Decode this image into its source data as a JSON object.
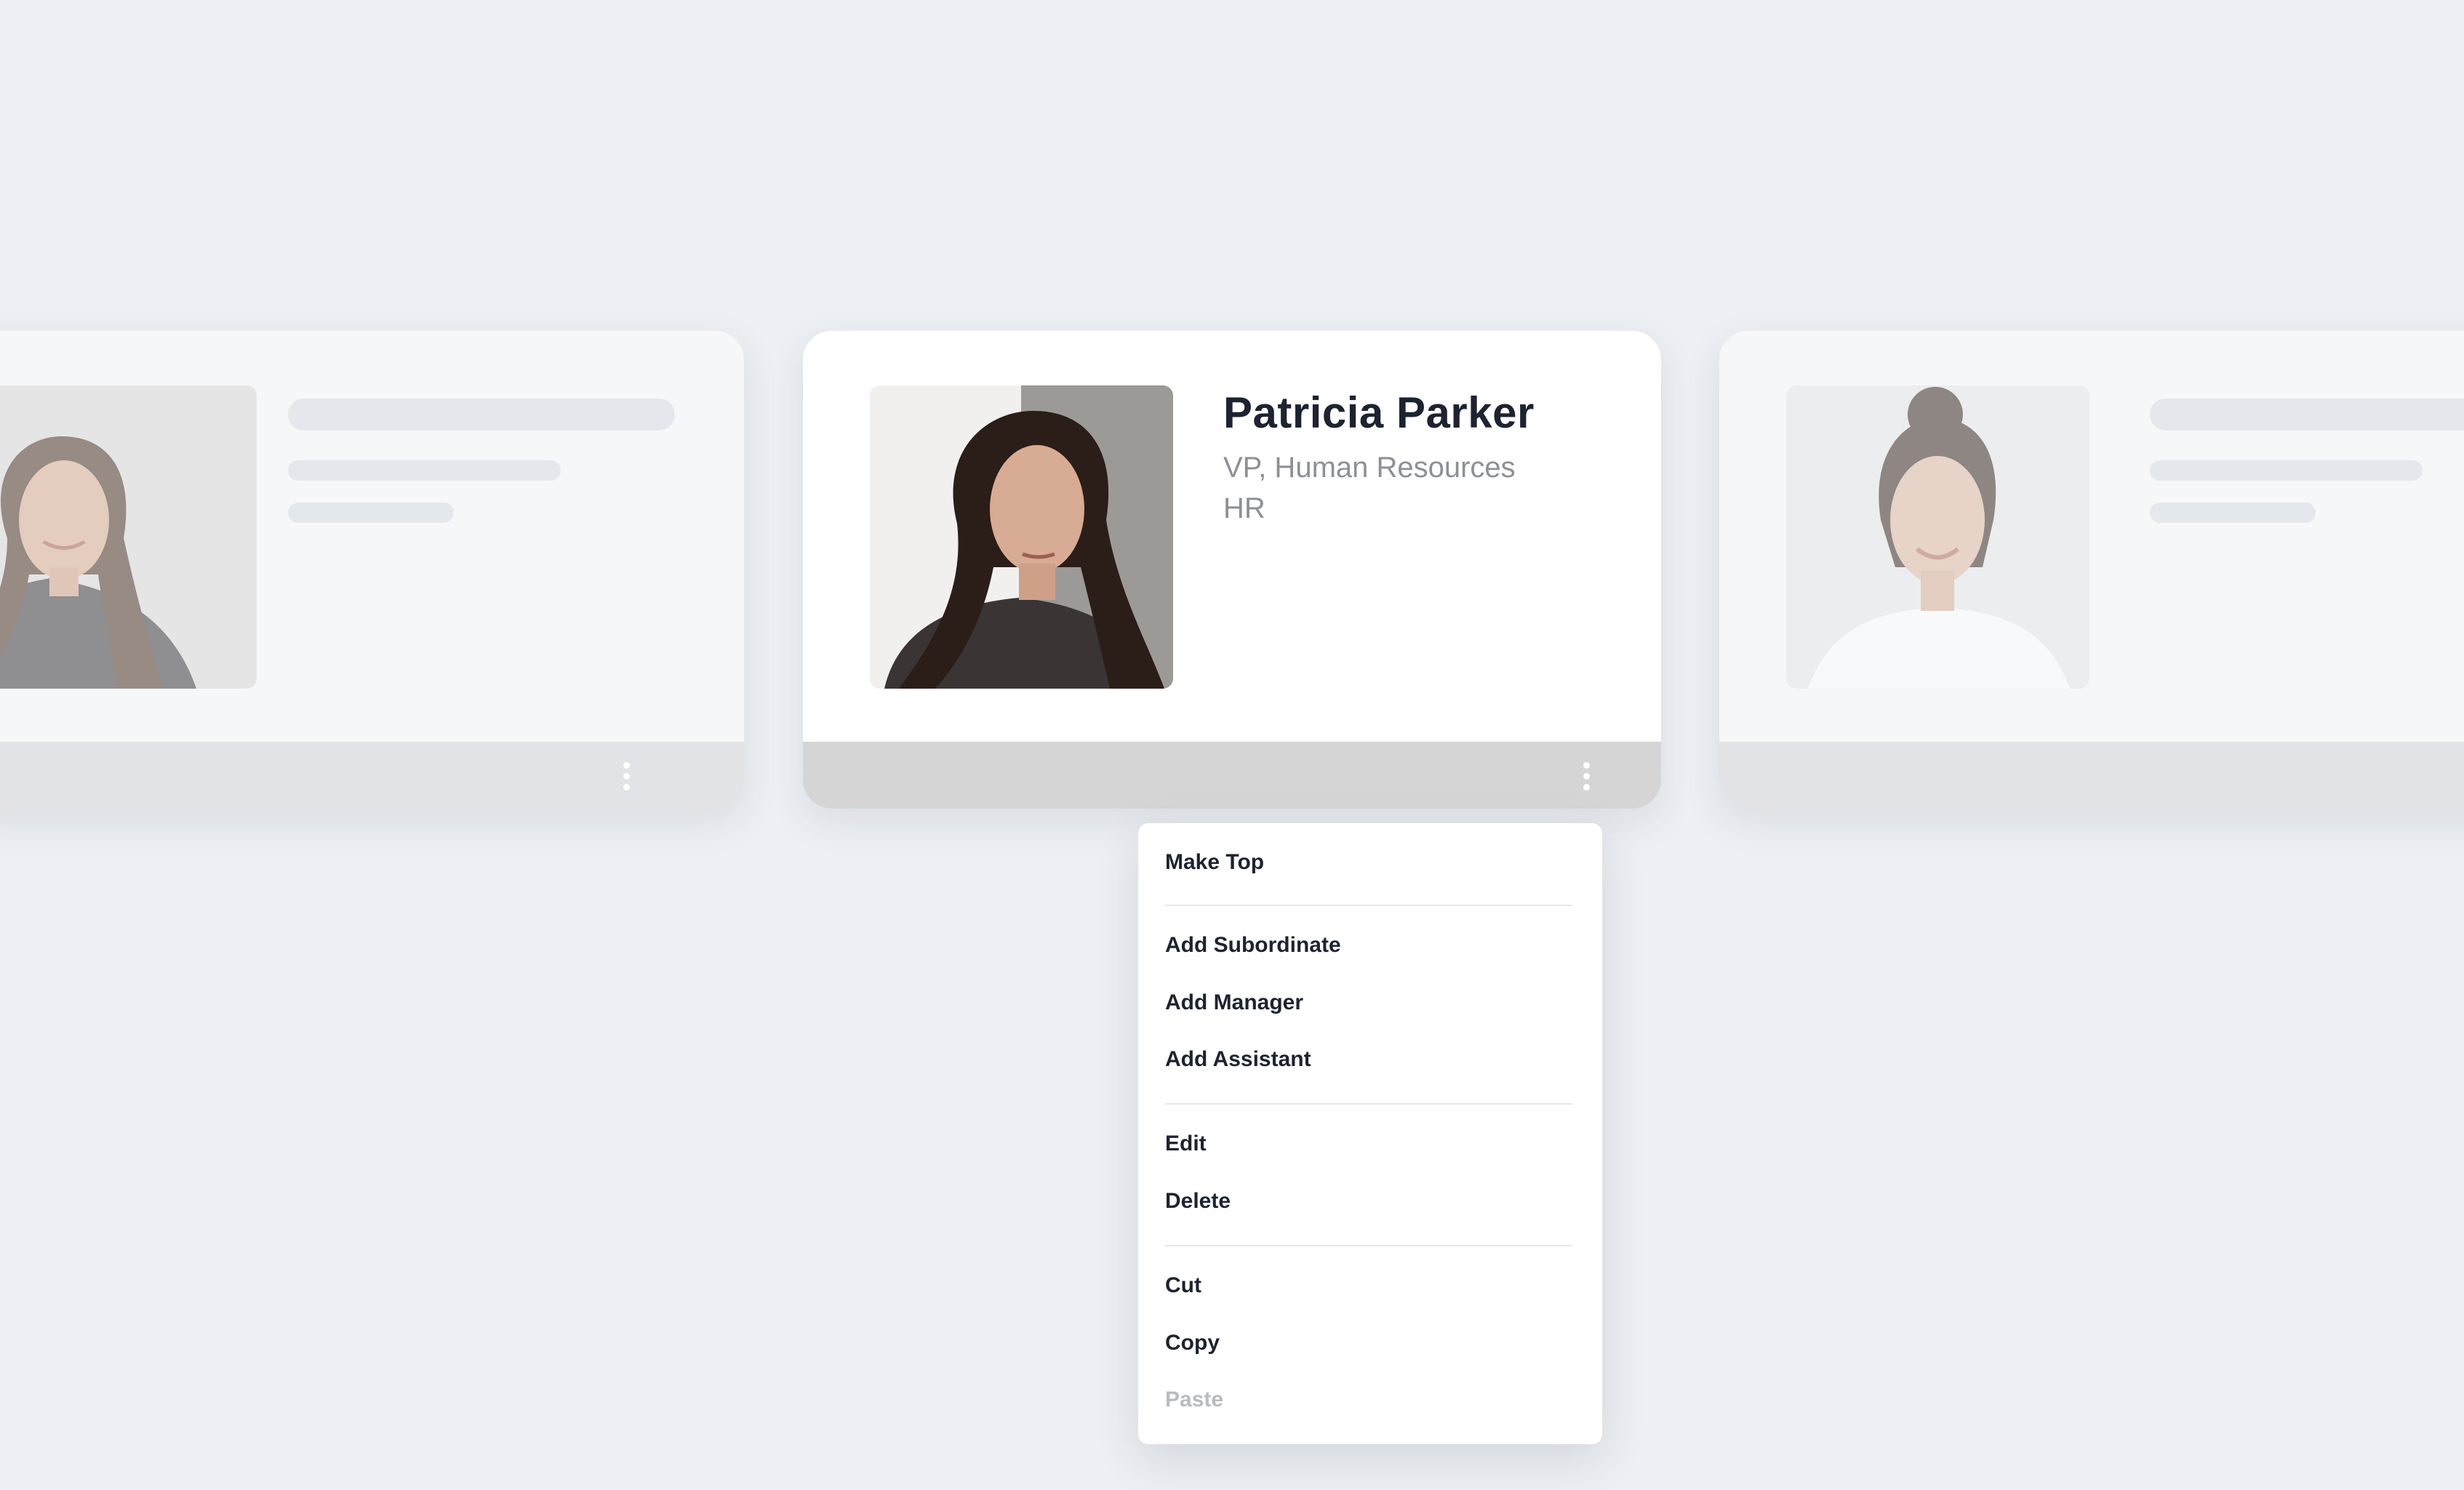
{
  "cards": {
    "focused": {
      "name": "Patricia Parker",
      "title": "VP, Human Resources",
      "department": "HR"
    }
  },
  "context_menu": {
    "items": [
      {
        "label": "Make Top",
        "enabled": true
      },
      {
        "label": "Add Subordinate",
        "enabled": true
      },
      {
        "label": "Add Manager",
        "enabled": true
      },
      {
        "label": "Add Assistant",
        "enabled": true
      },
      {
        "label": "Edit",
        "enabled": true
      },
      {
        "label": "Delete",
        "enabled": true
      },
      {
        "label": "Cut",
        "enabled": true
      },
      {
        "label": "Copy",
        "enabled": true
      },
      {
        "label": "Paste",
        "enabled": false
      }
    ]
  },
  "icons": {
    "card_menu": "more-vertical-icon"
  },
  "colors": {
    "background": "#eceff3",
    "card": "#ffffff",
    "card_footer": "#d5d5d5",
    "text_primary": "#1d2330",
    "text_secondary": "#8e9096",
    "disabled": "#b9bbbf"
  }
}
